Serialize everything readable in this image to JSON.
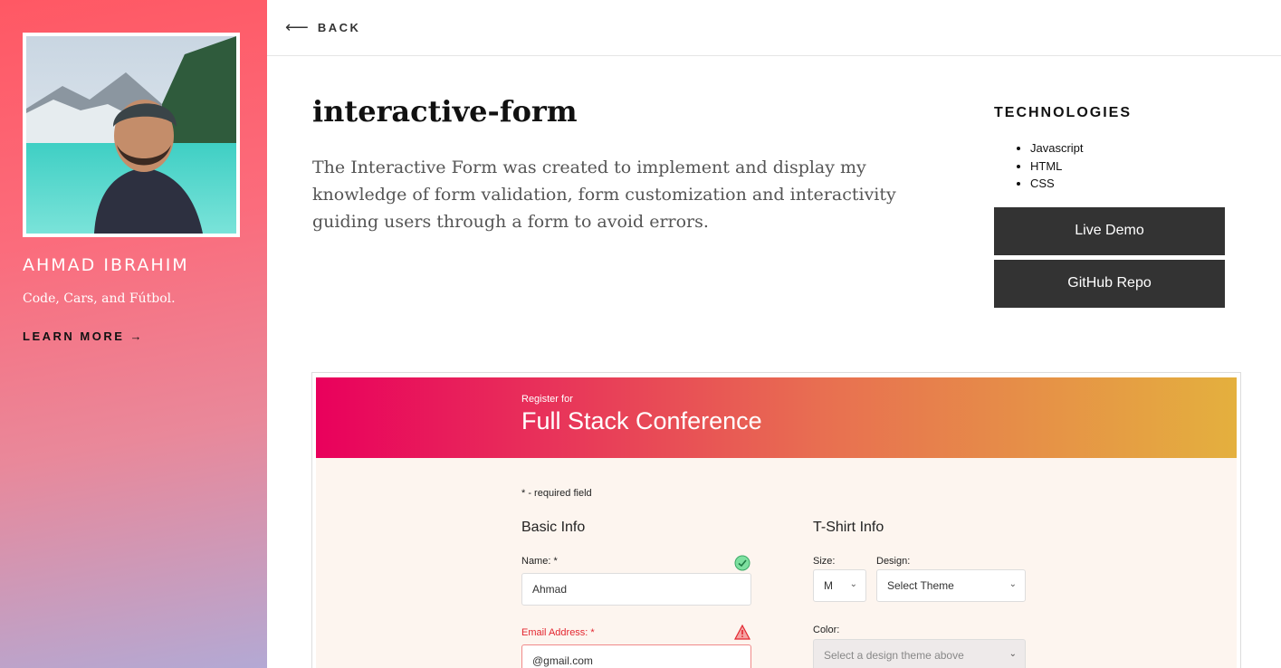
{
  "sidebar": {
    "name": "Ahmad Ibrahim",
    "tagline": "Code, Cars, and Fútbol.",
    "learn_more": "Learn more →"
  },
  "topbar": {
    "back_label": "BACK",
    "back_arrow": "⟵"
  },
  "project": {
    "title": "interactive-form",
    "description": "The Interactive Form was created to implement and display my knowledge of form validation, form customization and interactivity guiding users through a form to avoid errors."
  },
  "technologies": {
    "heading": "TECHNOLOGIES",
    "items": [
      "Javascript",
      "HTML",
      "CSS"
    ]
  },
  "buttons": {
    "live_demo": "Live Demo",
    "github_repo": "GitHub Repo"
  },
  "screenshot": {
    "register_for": "Register for",
    "conference": "Full Stack Conference",
    "required_note": "* - required field",
    "basic_info": "Basic Info",
    "tshirt_info": "T-Shirt Info",
    "name_label": "Name: *",
    "name_value": "Ahmad",
    "email_label": "Email Address: *",
    "email_value": "@gmail.com",
    "size_label": "Size:",
    "size_value": "M",
    "design_label": "Design:",
    "design_value": "Select Theme",
    "color_label": "Color:",
    "color_value": "Select a design theme above"
  },
  "colors": {
    "sidebar_gradient": [
      "#ff5864",
      "#b3a9d4"
    ],
    "button_bg": "#333333",
    "banner_gradient": [
      "#e9005c",
      "#e4b03e"
    ]
  }
}
